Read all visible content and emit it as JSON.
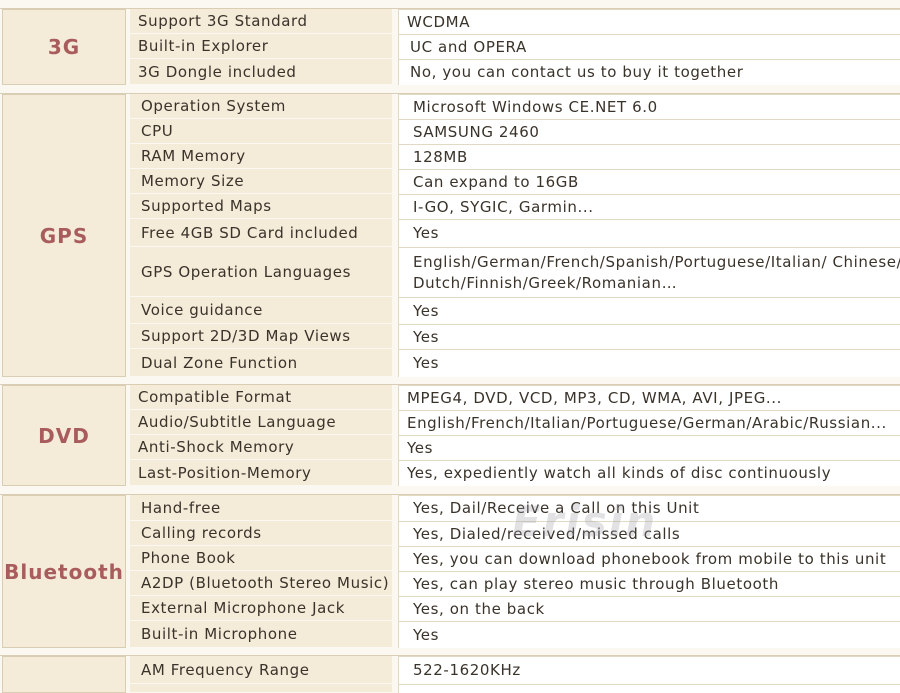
{
  "sections": [
    {
      "category": "3G",
      "rows": [
        {
          "label": "Support 3G Standard",
          "value": "WCDMA"
        },
        {
          "label": "Built-in Explorer",
          "value": "UC and OPERA"
        },
        {
          "label": "3G Dongle included",
          "value": "No, you can contact us to buy it together"
        }
      ]
    },
    {
      "category": "GPS",
      "rows": [
        {
          "label": "Operation System",
          "value": "Microsoft Windows CE.NET 6.0"
        },
        {
          "label": "CPU",
          "value": "SAMSUNG 2460"
        },
        {
          "label": "RAM Memory",
          "value": "128MB"
        },
        {
          "label": "Memory Size",
          "value": "Can expand to 16GB"
        },
        {
          "label": "Supported Maps",
          "value": "I-GO, SYGIC, Garmin..."
        },
        {
          "label": "Free 4GB SD Card included",
          "value": "Yes"
        },
        {
          "label": "GPS Operation Languages",
          "value": "English/German/French/Spanish/Portuguese/Italian/ Chinese/",
          "value2": "Dutch/Finnish/Greek/Romanian…"
        },
        {
          "label": "Voice guidance",
          "value": "Yes"
        },
        {
          "label": "Support 2D/3D Map Views",
          "value": "Yes"
        },
        {
          "label": "Dual Zone Function",
          "value": "Yes"
        }
      ]
    },
    {
      "category": "DVD",
      "rows": [
        {
          "label": "Compatible Format",
          "value": "MPEG4, DVD, VCD, MP3, CD, WMA, AVI, JPEG..."
        },
        {
          "label": "Audio/Subtitle Language",
          "value": "English/French/Italian/Portuguese/German/Arabic/Russian..."
        },
        {
          "label": "Anti-Shock Memory",
          "value": "Yes"
        },
        {
          "label": "Last-Position-Memory",
          "value": "Yes, expediently watch all kinds of disc continuously"
        }
      ]
    },
    {
      "category": "Bluetooth",
      "rows": [
        {
          "label": "Hand-free",
          "value": "Yes, Dail/Receive a Call on this Unit"
        },
        {
          "label": "Calling records",
          "value": "Yes, Dialed/received/missed calls"
        },
        {
          "label": "Phone Book",
          "value": "Yes, you can download phonebook from mobile to this unit"
        },
        {
          "label": "A2DP (Bluetooth Stereo Music)",
          "value": "Yes, can play stereo music through Bluetooth"
        },
        {
          "label": "External Microphone Jack",
          "value": "Yes, on the back"
        },
        {
          "label": "Built-in Microphone",
          "value": "Yes"
        }
      ]
    },
    {
      "category": "",
      "rows": [
        {
          "label": "AM Frequency Range",
          "value": "522-1620KHz"
        }
      ]
    }
  ],
  "watermark": "Erisin"
}
